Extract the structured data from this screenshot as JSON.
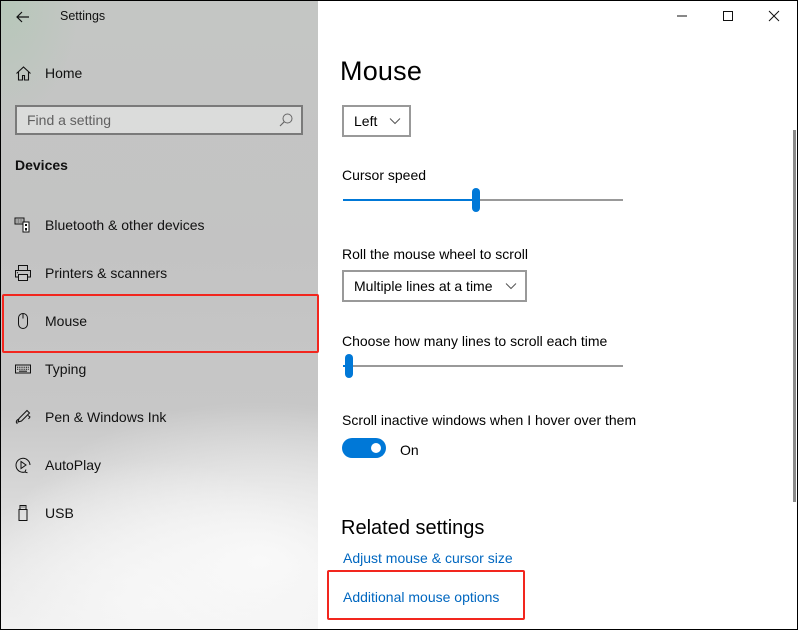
{
  "window": {
    "app_title": "Settings",
    "controls": {
      "minimize": "minimize",
      "maximize": "maximize",
      "close": "close"
    }
  },
  "sidebar": {
    "home_label": "Home",
    "search": {
      "placeholder": "Find a setting",
      "value": ""
    },
    "section_heading": "Devices",
    "items": [
      {
        "label": "Bluetooth & other devices",
        "icon": "bluetooth-devices-icon"
      },
      {
        "label": "Printers & scanners",
        "icon": "printer-icon"
      },
      {
        "label": "Mouse",
        "icon": "mouse-icon",
        "selected": true
      },
      {
        "label": "Typing",
        "icon": "keyboard-icon"
      },
      {
        "label": "Pen & Windows Ink",
        "icon": "pen-icon"
      },
      {
        "label": "AutoPlay",
        "icon": "autoplay-icon"
      },
      {
        "label": "USB",
        "icon": "usb-icon"
      }
    ]
  },
  "main": {
    "page_title": "Mouse",
    "primary_button": {
      "value": "Left"
    },
    "cursor_speed": {
      "label": "Cursor speed",
      "value": 10,
      "min": 1,
      "max": 20
    },
    "wheel_scroll": {
      "label": "Roll the mouse wheel to scroll",
      "value": "Multiple lines at a time"
    },
    "lines_to_scroll": {
      "label": "Choose how many lines to scroll each time",
      "value": 3,
      "min": 1,
      "max": 100
    },
    "scroll_inactive": {
      "label": "Scroll inactive windows when I hover over them",
      "state": "On",
      "checked": true
    },
    "related": {
      "heading": "Related settings",
      "links": [
        "Adjust mouse & cursor size",
        "Additional mouse options"
      ]
    }
  },
  "colors": {
    "accent": "#0078d7",
    "link": "#0067c0",
    "highlight": "#f2261e"
  }
}
